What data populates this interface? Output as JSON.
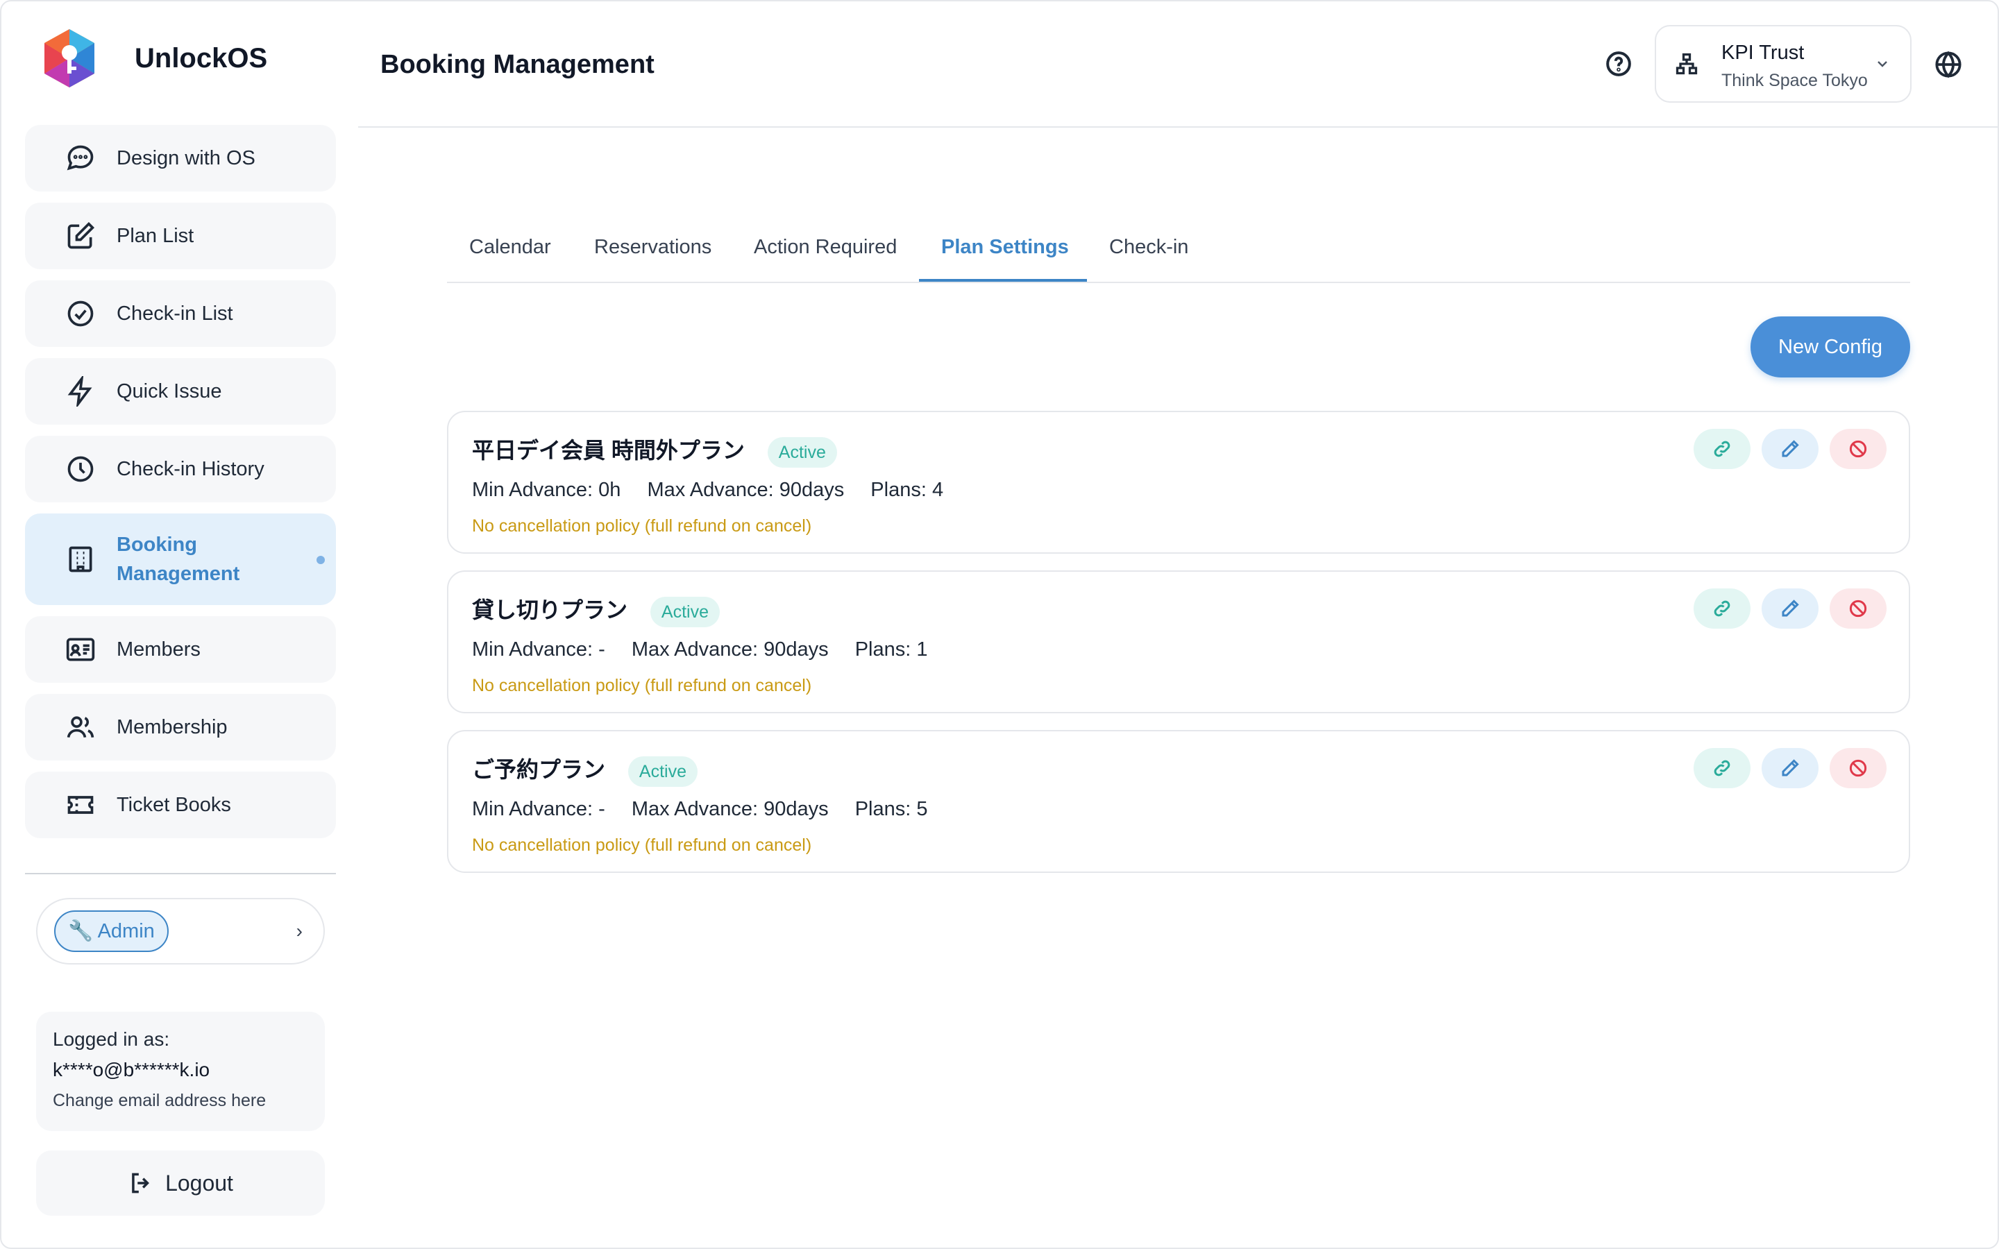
{
  "app": {
    "name": "UnlockOS"
  },
  "sidebar": {
    "items": [
      {
        "label": "Design with OS",
        "icon": "chat-bubble-icon"
      },
      {
        "label": "Plan List",
        "icon": "edit-square-icon"
      },
      {
        "label": "Check-in List",
        "icon": "check-circle-icon"
      },
      {
        "label": "Quick Issue",
        "icon": "lightning-icon"
      },
      {
        "label": "Check-in History",
        "icon": "clock-icon"
      },
      {
        "label": "Booking Management",
        "icon": "building-icon",
        "active": true
      },
      {
        "label": "Members",
        "icon": "id-card-icon"
      },
      {
        "label": "Membership",
        "icon": "users-icon"
      },
      {
        "label": "Ticket Books",
        "icon": "ticket-icon"
      }
    ],
    "admin_label": "🔧 Admin",
    "login": {
      "label": "Logged in as:",
      "email": "k****o@b******k.io",
      "change_link": "Change email address here"
    },
    "logout_label": "Logout"
  },
  "header": {
    "title": "Booking Management",
    "org_name": "KPI Trust",
    "org_location": "Think Space Tokyo"
  },
  "tabs": [
    "Calendar",
    "Reservations",
    "Action Required",
    "Plan Settings",
    "Check-in"
  ],
  "active_tab": "Plan Settings",
  "new_config_label": "New Config",
  "configs": [
    {
      "name": "平日デイ会員 時間外プラン",
      "status": "Active",
      "min_advance": "Min Advance: 0h",
      "max_advance": "Max Advance: 90days",
      "plans": "Plans: 4",
      "policy": "No cancellation policy (full refund on cancel)"
    },
    {
      "name": "貸し切りプラン",
      "status": "Active",
      "min_advance": "Min Advance: -",
      "max_advance": "Max Advance: 90days",
      "plans": "Plans: 1",
      "policy": "No cancellation policy (full refund on cancel)"
    },
    {
      "name": "ご予約プラン",
      "status": "Active",
      "min_advance": "Min Advance: -",
      "max_advance": "Max Advance: 90days",
      "plans": "Plans: 5",
      "policy": "No cancellation policy (full refund on cancel)"
    }
  ],
  "colors": {
    "accent": "#3d85c6",
    "button": "#4a8fd8",
    "active_badge": "#2aab9a",
    "policy": "#c99a14",
    "danger": "#e0394a"
  }
}
